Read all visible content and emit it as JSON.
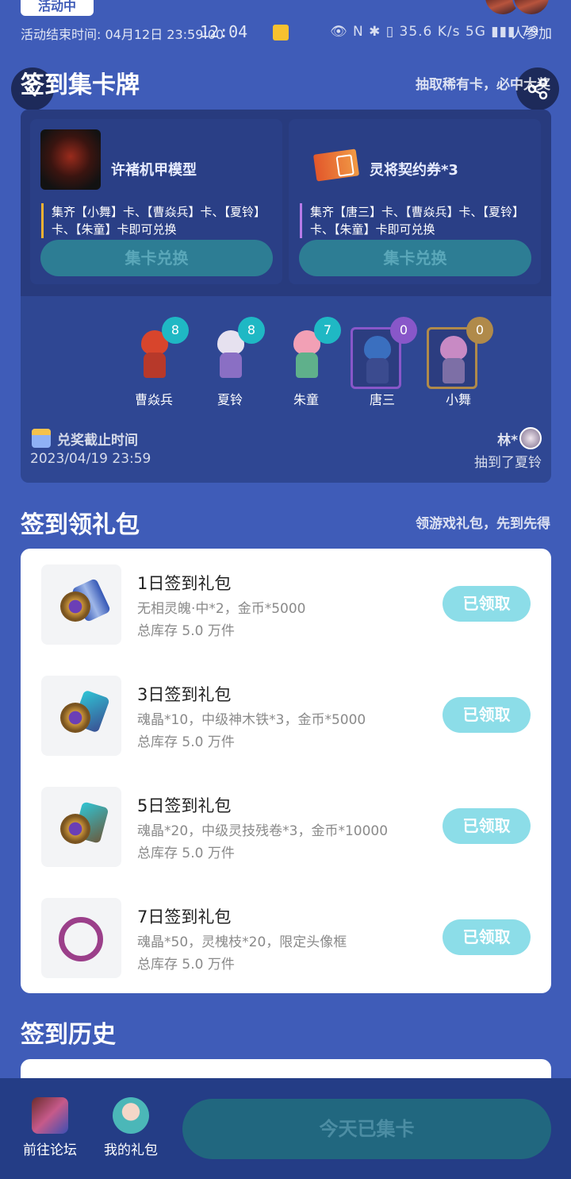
{
  "top": {
    "activity_tag": "活动中",
    "end_time": "活动结束时间: 04月12日 23:59:00",
    "clock": "12:04",
    "system_icons": "👁 N ✱ ▯ 35.6 K/s 5G ▮▮▮ 79",
    "join": "人参加"
  },
  "section_cards": {
    "title": "签到集卡牌",
    "subtitle": "抽取稀有卡，必中大奖"
  },
  "rewards": [
    {
      "name": "许褚机甲模型",
      "desc": "集齐【小舞】卡、【曹焱兵】卡、【夏铃】卡、【朱童】卡即可兑换",
      "button": "集卡兑换"
    },
    {
      "name": "灵将契约券*3",
      "desc": "集齐【唐三】卡、【曹焱兵】卡、【夏铃】卡、【朱童】卡即可兑换",
      "button": "集卡兑换"
    }
  ],
  "cards": [
    {
      "name": "曹焱兵",
      "count": "8",
      "badge_color": "#1fb8c4",
      "framed": false
    },
    {
      "name": "夏铃",
      "count": "8",
      "badge_color": "#1fb8c4",
      "framed": false
    },
    {
      "name": "朱童",
      "count": "7",
      "badge_color": "#1fb8c4",
      "framed": false
    },
    {
      "name": "唐三",
      "count": "0",
      "badge_color": "#8857c9",
      "framed": true,
      "frame_color": "#8857c9"
    },
    {
      "name": "小舞",
      "count": "0",
      "badge_color": "#b08a4a",
      "framed": true,
      "frame_color": "#b08a4a"
    }
  ],
  "deadline": {
    "label": "兑奖截止时间",
    "date": "2023/04/19 23:59"
  },
  "winner": {
    "name": "林*",
    "text": "抽到了夏铃"
  },
  "section_gifts": {
    "title": "签到领礼包",
    "subtitle": "领游戏礼包，先到先得"
  },
  "gifts": [
    {
      "title": "1日签到礼包",
      "desc": "无相灵魄·中*2，金币*5000",
      "stock": "总库存 5.0 万件",
      "button": "已领取",
      "icon": "coin-scroll-icon"
    },
    {
      "title": "3日签到礼包",
      "desc": "魂晶*10，中级神木铁*3，金币*5000",
      "stock": "总库存 5.0 万件",
      "button": "已领取",
      "icon": "crystal-coin-icon"
    },
    {
      "title": "5日签到礼包",
      "desc": "魂晶*20，中级灵技残卷*3，金币*10000",
      "stock": "总库存 5.0 万件",
      "button": "已领取",
      "icon": "crystal-scroll-icon"
    },
    {
      "title": "7日签到礼包",
      "desc": "魂晶*50，灵槐枝*20，限定头像框",
      "stock": "总库存 5.0 万件",
      "button": "已领取",
      "icon": "avatar-frame-icon"
    }
  ],
  "section_history": {
    "title": "签到历史"
  },
  "bottom": {
    "forum": "前往论坛",
    "my_gifts": "我的礼包",
    "collected": "今天已集卡"
  },
  "colors": {
    "background": "#3f5cb8",
    "panel": "#2f4793",
    "claimed_button": "#8cdde8",
    "redeem_button": "#2d7d94",
    "bottom_bar": "#243d86"
  }
}
